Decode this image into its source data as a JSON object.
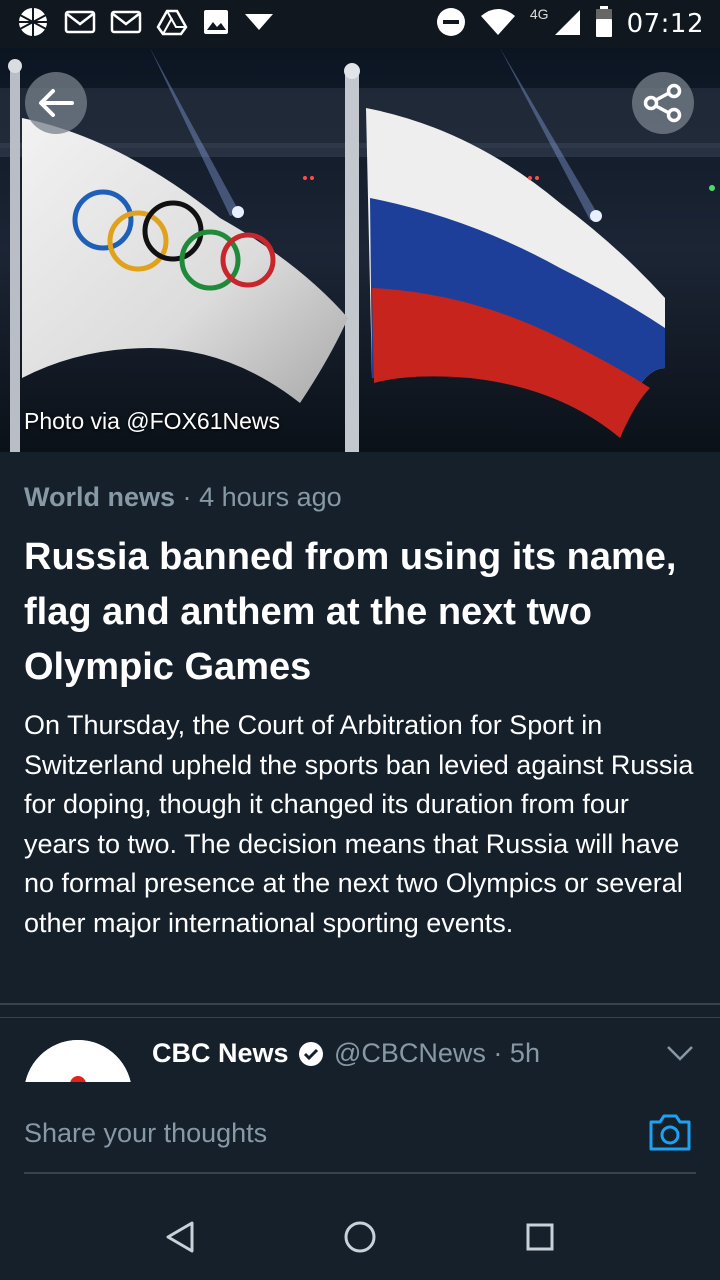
{
  "status_bar": {
    "time": "07:12",
    "network": "4G",
    "icons": [
      "grid-globe-icon",
      "gmail-icon",
      "gmail-icon",
      "drive-icon",
      "image-icon",
      "dropdown-icon",
      "dnd-icon",
      "wifi-icon",
      "signal-icon",
      "battery-icon"
    ]
  },
  "hero": {
    "photo_credit": "Photo via @FOX61News",
    "back_icon": "back-arrow-icon",
    "share_icon": "share-icon"
  },
  "article": {
    "category": "World news",
    "separator": "·",
    "time_ago": "4 hours ago",
    "headline": "Russia banned from using its name, flag and anthem at the next two Olympic Games",
    "summary": "On Thursday, the Court of Arbitration for Sport in Switzerland upheld the sports ban levied against Russia for doping, though it changed its duration from four years to two. The decision means that Russia will have no formal presence at the next two Olympics or several other major international sporting events."
  },
  "tweet": {
    "author": "CBC News",
    "handle": "@CBCNews · 5h",
    "verified": true
  },
  "composer": {
    "placeholder": "Share your thoughts"
  },
  "colors": {
    "background": "#15202b",
    "secondary_text": "#8899a6",
    "accent": "#1da1f2",
    "divider": "#38444d"
  }
}
